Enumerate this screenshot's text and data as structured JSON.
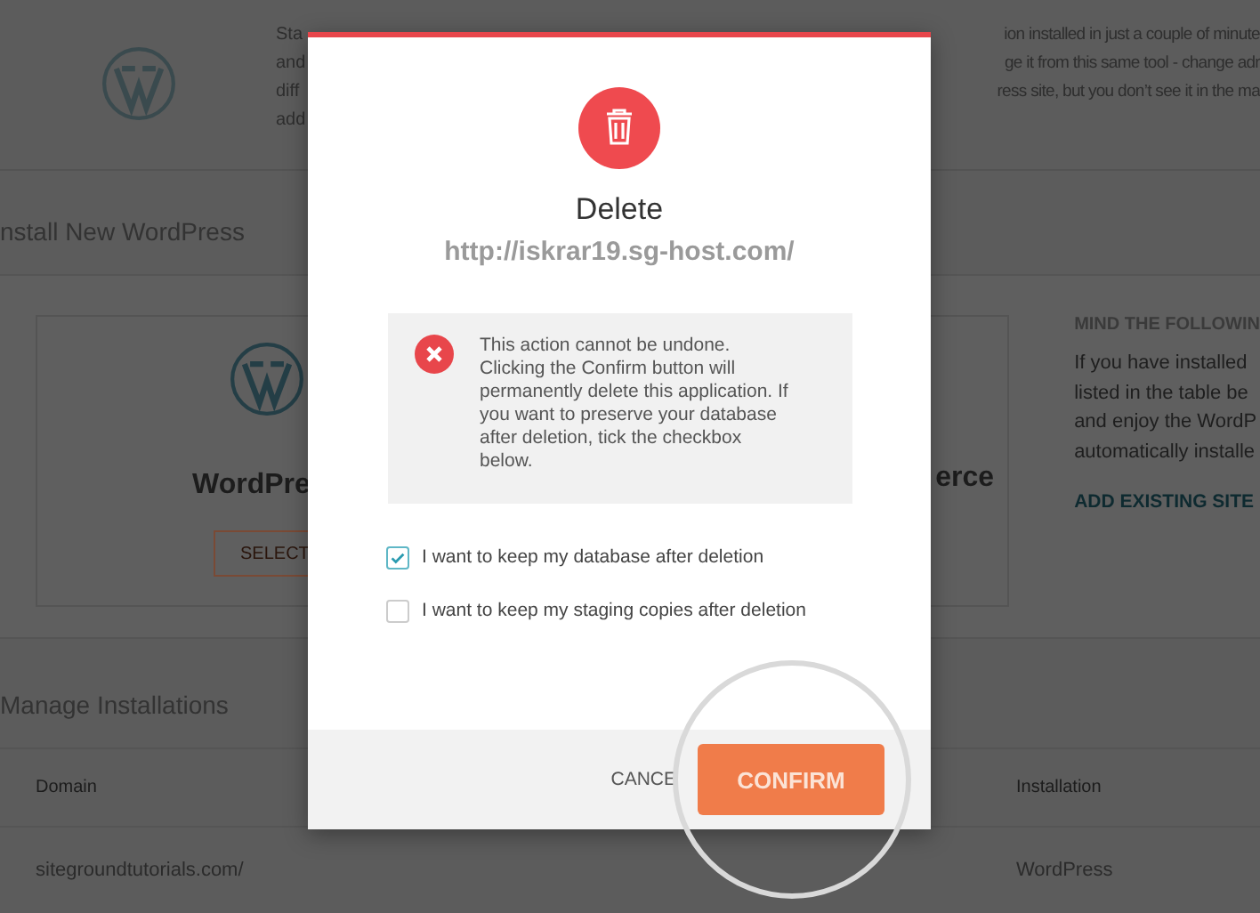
{
  "background": {
    "intro": {
      "lines": [
        {
          "left": "Sta",
          "right": "ion installed in just a couple of minute"
        },
        {
          "left": "and",
          "right": "ge it from this same tool - change adr"
        },
        {
          "left": "diff",
          "right": "ress site, but you don’t see it in the ma"
        },
        {
          "left": "add"
        }
      ]
    },
    "install": {
      "title": "nstall New WordPress",
      "cards": [
        {
          "kind": "left",
          "name": "WordPre",
          "button": "SELECT"
        },
        {
          "kind": "right",
          "name": "erce"
        }
      ],
      "notice": {
        "heading": "MIND THE FOLLOWIN",
        "lines": [
          "If you have installed",
          "listed in the table be",
          "and enjoy the WordP",
          "automatically installe"
        ],
        "link": "ADD EXISTING SITE"
      }
    },
    "manage": {
      "title": "Manage Installations",
      "columns": [
        "Domain",
        "Installation"
      ],
      "rows": [
        [
          "sitegroundtutorials.com/",
          "WordPress"
        ]
      ]
    }
  },
  "dialog": {
    "title": "Delete",
    "url": "http://iskrar19.sg-host.com/",
    "alert": "This action cannot be undone. Clicking the Confirm button will permanently delete this application. If you want to preserve your database after deletion, tick the checkbox below.",
    "checkboxes": [
      {
        "label": "I want to keep my database after deletion",
        "checked": true
      },
      {
        "label": "I want to keep my staging copies after deletion",
        "checked": false
      }
    ],
    "cancel": "CANCE",
    "confirm": "CONFIRM"
  }
}
